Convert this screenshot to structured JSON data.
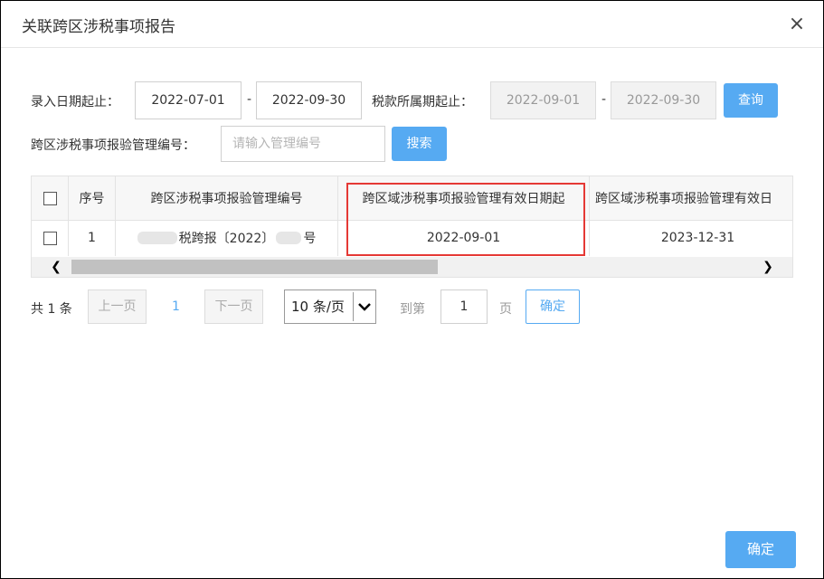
{
  "dialog": {
    "title": "关联跨区涉税事项报告",
    "close_icon": "×"
  },
  "filters": {
    "entry_date_label": "录入日期起止：",
    "entry_date_from": "2022-07-01",
    "entry_date_to": "2022-09-30",
    "tax_period_label": "税款所属期起止：",
    "tax_period_from": "2022-09-01",
    "tax_period_to": "2022-09-30",
    "query_button": "查询",
    "mgmt_no_label": "跨区涉税事项报验管理编号：",
    "mgmt_no_placeholder": "请输入管理编号",
    "search_button": "搜索",
    "dash": "-"
  },
  "table": {
    "headers": [
      "序号",
      "跨区涉税事项报验管理编号",
      "跨区域涉税事项报验管理有效日期起",
      "跨区域涉税事项报验管理有效日"
    ],
    "rows": [
      {
        "index": "1",
        "mgmt_no_mid": "税跨报〔2022〕",
        "mgmt_no_suffix": "号",
        "valid_from": "2022-09-01",
        "valid_to": "2023-12-31"
      }
    ],
    "scroll_left_icon": "❮",
    "scroll_right_icon": "❯"
  },
  "pagination": {
    "total": "共 1 条",
    "prev": "上一页",
    "current": "1",
    "next": "下一页",
    "page_size": "10 条/页",
    "caret_icon": "⌄",
    "goto_label": "到第",
    "goto_value": "1",
    "page_unit": "页",
    "goto_button": "确定"
  },
  "footer": {
    "confirm_button": "确定"
  },
  "colors": {
    "accent": "#56aaf2",
    "highlight": "#e53935"
  }
}
